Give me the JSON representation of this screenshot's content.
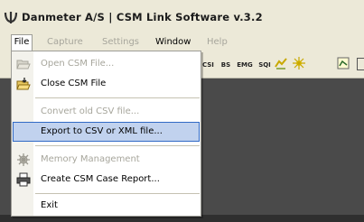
{
  "window": {
    "title": "Danmeter A/S | CSM Link Software v.3.2"
  },
  "menubar": {
    "items": [
      {
        "label": "File",
        "state": "open"
      },
      {
        "label": "Capture",
        "state": "disabled"
      },
      {
        "label": "Settings",
        "state": "disabled"
      },
      {
        "label": "Window",
        "state": "enabled"
      },
      {
        "label": "Help",
        "state": "disabled"
      }
    ]
  },
  "toolbar": {
    "buttons": [
      "CSI",
      "BS",
      "EMG",
      "SQI"
    ],
    "icons": [
      "chart-icon",
      "star-icon",
      "document-icon"
    ]
  },
  "file_menu": {
    "items": [
      {
        "label": "Open CSM File...",
        "disabled": true,
        "icon": "open-folder-icon"
      },
      {
        "label": "Close CSM File",
        "disabled": false,
        "icon": "close-folder-icon"
      },
      {
        "label": "Convert old CSV file...",
        "disabled": true
      },
      {
        "label": "Export to CSV or XML file...",
        "disabled": false,
        "highlighted": true
      },
      {
        "label": "Memory Management",
        "disabled": true,
        "icon": "memory-icon"
      },
      {
        "label": "Create CSM Case Report...",
        "disabled": false,
        "icon": "printer-icon"
      },
      {
        "label": "Exit",
        "disabled": false
      }
    ]
  },
  "colors": {
    "chrome": "#ece9d8",
    "workspace": "#4a4a4a",
    "highlight": "#c1d2ee",
    "highlight_border": "#316ac5",
    "disabled_text": "#a7a69c"
  }
}
